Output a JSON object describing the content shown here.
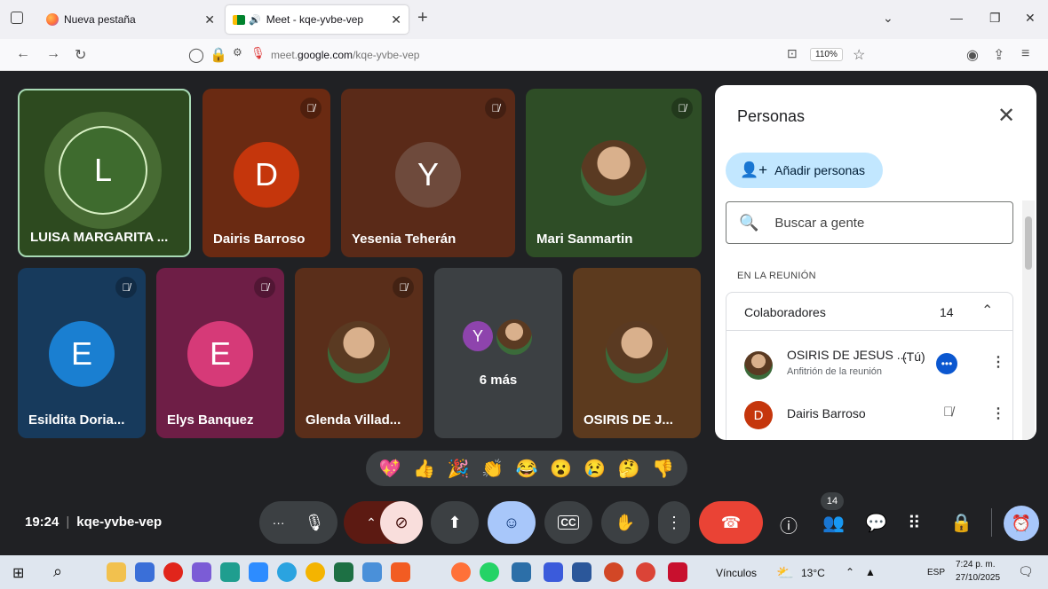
{
  "browser": {
    "tabs": [
      {
        "title": "Nueva pestaña",
        "active": false
      },
      {
        "title": "Meet - kqe-yvbe-vep",
        "active": true
      }
    ],
    "url_prefix": "meet.",
    "url_domain": "google.com",
    "url_path": "/kqe-yvbe-vep",
    "zoom": "110%"
  },
  "tiles": [
    {
      "name": "LUISA MARGARITA ...",
      "initial": "L",
      "muted": false
    },
    {
      "name": "Dairis Barroso",
      "initial": "D",
      "muted": true
    },
    {
      "name": "Yesenia Teherán",
      "initial": "Y",
      "muted": true
    },
    {
      "name": "Mari Sanmartin",
      "initial": "",
      "muted": true
    },
    {
      "name": "Esildita Doria...",
      "initial": "E",
      "muted": true
    },
    {
      "name": "Elys Banquez",
      "initial": "E",
      "muted": true
    },
    {
      "name": "Glenda Villad...",
      "initial": "",
      "muted": true
    },
    {
      "name": "6 más",
      "initial": "Y",
      "muted": false
    },
    {
      "name": "OSIRIS DE J...",
      "initial": "",
      "muted": false
    }
  ],
  "panel": {
    "title": "Personas",
    "add_label": "Añadir personas",
    "search_placeholder": "Buscar a gente",
    "section": "EN LA REUNIÓN",
    "group_label": "Colaboradores",
    "group_count": "14",
    "people": [
      {
        "name": "OSIRIS DE JESUS ...",
        "tag": "(Tú)",
        "role": "Anfitrión de la reunión"
      },
      {
        "name": "Dairis Barroso",
        "initial": "D"
      }
    ]
  },
  "reactions": [
    "💖",
    "👍",
    "🎉",
    "👏",
    "😂",
    "😮",
    "😢",
    "🤔",
    "👎"
  ],
  "meeting": {
    "time": "19:24",
    "code": "kqe-yvbe-vep",
    "participants_badge": "14"
  },
  "taskbar": {
    "vinculos": "Vínculos",
    "temp": "13°C",
    "lang": "ESP",
    "time": "7:24 p. m.",
    "date": "27/10/2025"
  },
  "colors": {
    "accent": "#0b57d0",
    "hangup": "#ea4335",
    "camera_off": "#f9dedc"
  }
}
